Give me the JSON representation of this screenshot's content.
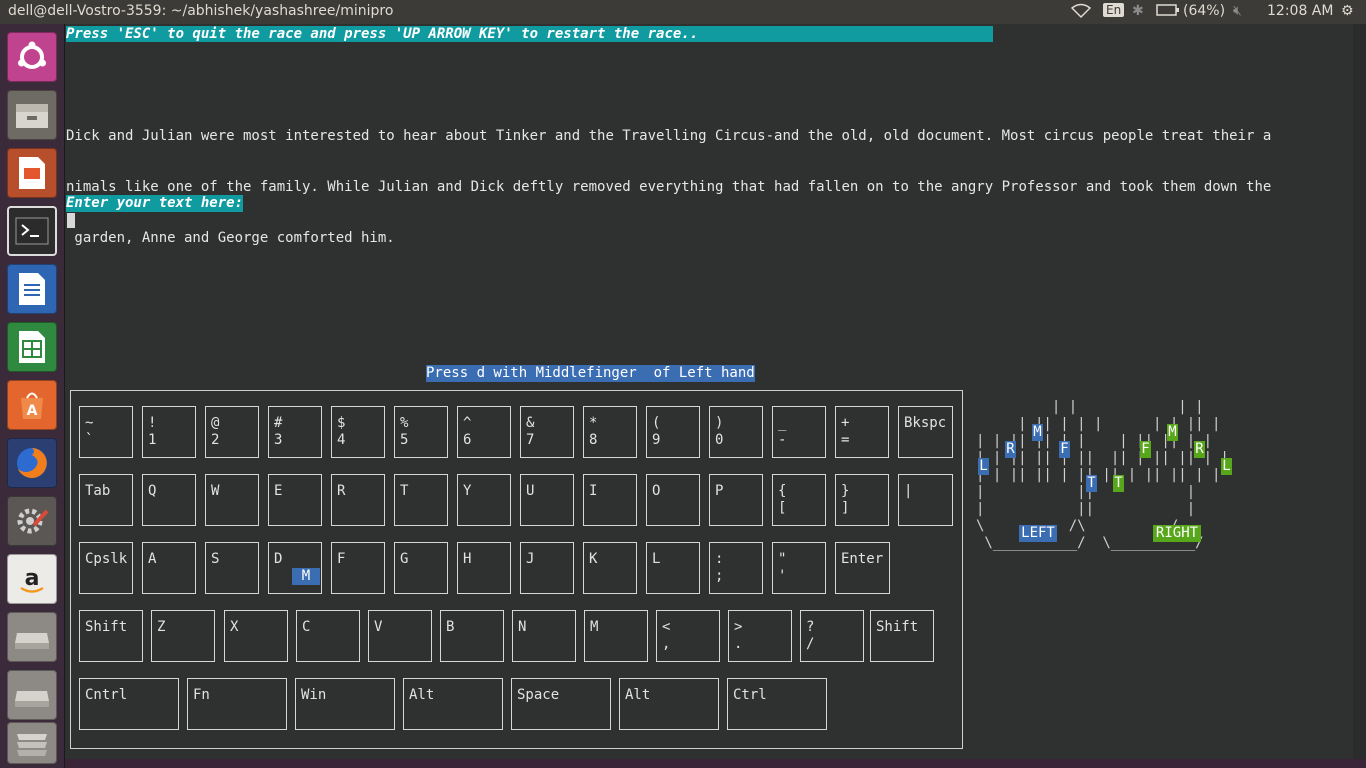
{
  "window": {
    "title": "dell@dell-Vostro-3559: ~/abhishek/yashashree/minipro"
  },
  "panel": {
    "keyboard_layout": "En",
    "battery": "(64%)",
    "clock": "12:08 AM",
    "icons": [
      "wifi-icon",
      "bluetooth-icon",
      "battery-icon",
      "volume-muted-icon",
      "gear-icon"
    ]
  },
  "launcher": {
    "items": [
      "ubuntu-dash-icon",
      "files-icon",
      "impress-icon",
      "terminal-icon",
      "writer-icon",
      "calc-icon",
      "software-center-icon",
      "firefox-icon",
      "system-settings-icon",
      "amazon-icon",
      "drive-icon",
      "drive-icon",
      "trash-icon"
    ],
    "active_index": 3
  },
  "terminal": {
    "banner": "Press 'ESC' to quit the race and press 'UP ARROW KEY' to restart the race..",
    "passage": [
      "Dick and Julian were most interested to hear about Tinker and the Travelling Circus-and the old, old document. Most circus people treat their a",
      "nimals like one of the family. While Julian and Dick deftly removed everything that had fallen on to the angry Professor and took them down the",
      " garden, Anne and George comforted him."
    ],
    "prompt": "Enter your text here:",
    "hint": "Press d with Middlefinger  of Left hand"
  },
  "keyboard": {
    "rows": [
      [
        {
          "t": "~",
          "b": "`"
        },
        {
          "t": "!",
          "b": "1"
        },
        {
          "t": "@",
          "b": "2"
        },
        {
          "t": "#",
          "b": "3"
        },
        {
          "t": "$",
          "b": "4"
        },
        {
          "t": "%",
          "b": "5"
        },
        {
          "t": "^",
          "b": "6"
        },
        {
          "t": "&",
          "b": "7"
        },
        {
          "t": "*",
          "b": "8"
        },
        {
          "t": "(",
          "b": "9"
        },
        {
          "t": ")",
          "b": "0"
        },
        {
          "t": "_",
          "b": "-"
        },
        {
          "t": "+",
          "b": "="
        },
        {
          "t": "Bkspc",
          "b": ""
        }
      ],
      [
        {
          "t": "Tab",
          "b": ""
        },
        {
          "t": "Q",
          "b": ""
        },
        {
          "t": "W",
          "b": ""
        },
        {
          "t": "E",
          "b": ""
        },
        {
          "t": "R",
          "b": ""
        },
        {
          "t": "T",
          "b": ""
        },
        {
          "t": "Y",
          "b": ""
        },
        {
          "t": "U",
          "b": ""
        },
        {
          "t": "I",
          "b": ""
        },
        {
          "t": "O",
          "b": ""
        },
        {
          "t": "P",
          "b": ""
        },
        {
          "t": "{",
          "b": "["
        },
        {
          "t": "}",
          "b": "]"
        },
        {
          "t": "|",
          "b": ""
        }
      ],
      [
        {
          "t": "Cpslk",
          "b": ""
        },
        {
          "t": "A",
          "b": ""
        },
        {
          "t": "S",
          "b": ""
        },
        {
          "t": "D",
          "b": "",
          "mark": "M"
        },
        {
          "t": "F",
          "b": ""
        },
        {
          "t": "G",
          "b": ""
        },
        {
          "t": "H",
          "b": ""
        },
        {
          "t": "J",
          "b": ""
        },
        {
          "t": "K",
          "b": ""
        },
        {
          "t": "L",
          "b": ""
        },
        {
          "t": ":",
          "b": ";"
        },
        {
          "t": "\"",
          "b": "'"
        },
        {
          "t": "Enter",
          "b": ""
        }
      ],
      [
        {
          "t": "Shift",
          "b": ""
        },
        {
          "t": "Z",
          "b": ""
        },
        {
          "t": "X",
          "b": ""
        },
        {
          "t": "C",
          "b": ""
        },
        {
          "t": "V",
          "b": ""
        },
        {
          "t": "B",
          "b": ""
        },
        {
          "t": "N",
          "b": ""
        },
        {
          "t": "M",
          "b": ""
        },
        {
          "t": "<",
          "b": ","
        },
        {
          "t": ">",
          "b": "."
        },
        {
          "t": "?",
          "b": "/"
        },
        {
          "t": "Shift",
          "b": ""
        }
      ],
      [
        {
          "t": "Cntrl",
          "b": ""
        },
        {
          "t": "Fn",
          "b": ""
        },
        {
          "t": "Win",
          "b": ""
        },
        {
          "t": "Alt",
          "b": ""
        },
        {
          "t": "Space",
          "b": ""
        },
        {
          "t": "Alt",
          "b": ""
        },
        {
          "t": "Ctrl",
          "b": ""
        }
      ]
    ]
  },
  "hands": {
    "art": [
      "         | |            | |",
      "     | || | | |      | | || |",
      "| | || || | |    | || || | |",
      "| | || || | ||  || | || || | |",
      "| | || || | || || | || || | |",
      "|           ||           |",
      "|           ||           |",
      "\\          /\\          /",
      " \\__________/  \\__________/"
    ],
    "left_label": "LEFT",
    "right_label": "RIGHT",
    "left_fingers": [
      "L",
      "R",
      "M",
      "F",
      "T"
    ],
    "right_fingers": [
      "T",
      "F",
      "M",
      "R",
      "L"
    ]
  }
}
